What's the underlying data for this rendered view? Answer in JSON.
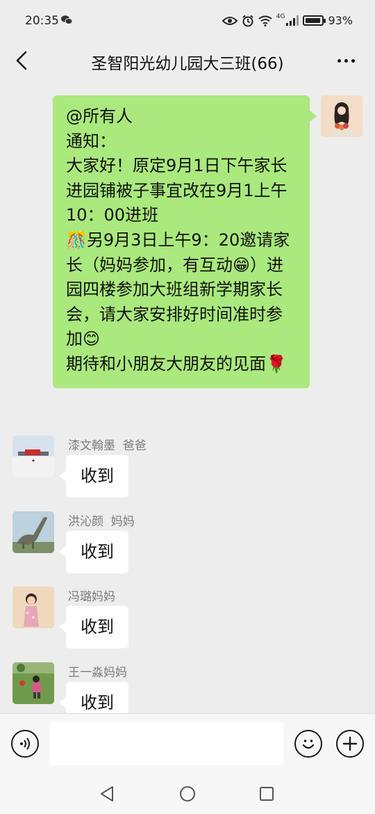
{
  "status_bar": {
    "time": "20:35",
    "network": "4G",
    "battery_percent": "93%",
    "battery_level": 0.93
  },
  "header": {
    "title": "圣智阳光幼儿园大三班(66)"
  },
  "self_message": {
    "text": "@所有人\n通知：\n大家好！原定9月1日下午家长进园铺被子事宜改在9月1上午10：00进班\n🎊另9月3日上午9：20邀请家长（妈妈参加，有互动😁）进园四楼参加大班组新学期家长会，请大家安排好时间准时参加😊\n期待和小朋友大朋友的见面🌹"
  },
  "messages": [
    {
      "sender": "漆文翰墨  爸爸",
      "text": "收到",
      "avatar": "snow-field-photo"
    },
    {
      "sender": "洪沁颜  妈妈",
      "text": "收到",
      "avatar": "dinosaur-statue-photo"
    },
    {
      "sender": "冯璐妈妈",
      "text": "收到",
      "avatar": "child-portrait-photo"
    },
    {
      "sender": "王一淼妈妈",
      "text": "收到",
      "avatar": "child-on-grass-photo"
    }
  ],
  "input": {
    "value": "",
    "placeholder": ""
  },
  "icons": {
    "back": "chevron-left-icon",
    "more": "more-horizontal-icon",
    "voice": "voice-icon",
    "emoji": "emoji-icon",
    "add": "plus-icon"
  },
  "colors": {
    "background": "#ededed",
    "self_bubble": "#a9e97d",
    "other_bubble": "#ffffff",
    "sender_name": "#7b7b7b"
  }
}
